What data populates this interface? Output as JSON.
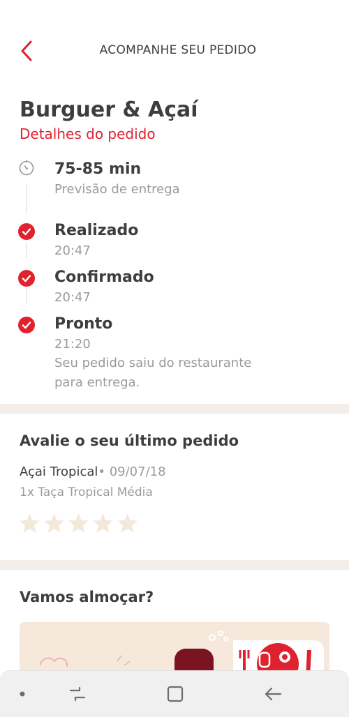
{
  "header": {
    "title": "ACOMPANHE SEU PEDIDO",
    "back_icon": "chevron-left-icon"
  },
  "order": {
    "restaurant": "Burguer & Açaí",
    "details_link": "Detalhes do pedido",
    "eta": {
      "time": "75-85 min",
      "label": "Previsão de entrega",
      "icon": "timer-icon"
    },
    "steps": [
      {
        "title": "Realizado",
        "time": "20:47",
        "status": "done"
      },
      {
        "title": "Confirmado",
        "time": "20:47",
        "status": "done"
      },
      {
        "title": "Pronto",
        "time": "21:20",
        "note_line1": "Seu pedido saiu do restaurante",
        "note_line2": "para entrega.",
        "status": "done"
      }
    ]
  },
  "rating": {
    "title": "Avalie o seu último pedido",
    "restaurant": "Açai Tropical",
    "date": "• 09/07/18",
    "item": "1x Taça Tropical Média",
    "stars_filled": 0,
    "stars_total": 5
  },
  "promo": {
    "title": "Vamos almoçar?"
  },
  "navbar": {
    "items": [
      "dot-icon",
      "recent-apps-icon",
      "home-icon",
      "back-arrow-icon"
    ]
  },
  "colors": {
    "accent": "#e0222f",
    "divider": "#f3eeea",
    "star_empty": "#f3e9da",
    "banner_bg": "#f6e9dc"
  }
}
